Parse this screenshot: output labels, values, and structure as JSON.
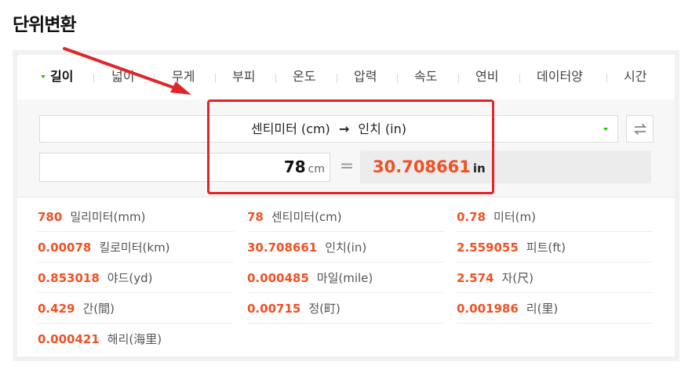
{
  "page_title": "단위변환",
  "tabs": [
    {
      "label": "길이",
      "active": true
    },
    {
      "label": "넓이",
      "active": false
    },
    {
      "label": "무게",
      "active": false
    },
    {
      "label": "부피",
      "active": false
    },
    {
      "label": "온도",
      "active": false
    },
    {
      "label": "압력",
      "active": false
    },
    {
      "label": "속도",
      "active": false
    },
    {
      "label": "연비",
      "active": false
    },
    {
      "label": "데이터양",
      "active": false
    },
    {
      "label": "시간",
      "active": false
    }
  ],
  "converter": {
    "from_unit": "센티미터 (cm)",
    "arrow": "→",
    "to_unit": "인치 (in)",
    "input_value": "78",
    "input_unit": "cm",
    "equals": "=",
    "result_value": "30.708661",
    "result_unit": "in"
  },
  "results": [
    {
      "value": "780",
      "label": "밀리미터(mm)"
    },
    {
      "value": "78",
      "label": "센티미터(cm)"
    },
    {
      "value": "0.78",
      "label": "미터(m)"
    },
    {
      "value": "0.00078",
      "label": "킬로미터(km)"
    },
    {
      "value": "30.708661",
      "label": "인치(in)"
    },
    {
      "value": "2.559055",
      "label": "피트(ft)"
    },
    {
      "value": "0.853018",
      "label": "야드(yd)"
    },
    {
      "value": "0.000485",
      "label": "마일(mile)"
    },
    {
      "value": "2.574",
      "label": "자(尺)"
    },
    {
      "value": "0.429",
      "label": "간(間)"
    },
    {
      "value": "0.00715",
      "label": "정(町)"
    },
    {
      "value": "0.001986",
      "label": "리(里)"
    },
    {
      "value": "0.000421",
      "label": "해리(海里)"
    }
  ],
  "colors": {
    "accent_green": "#1ec800",
    "value_orange": "#f05123",
    "annotation_red": "#e0252b"
  }
}
